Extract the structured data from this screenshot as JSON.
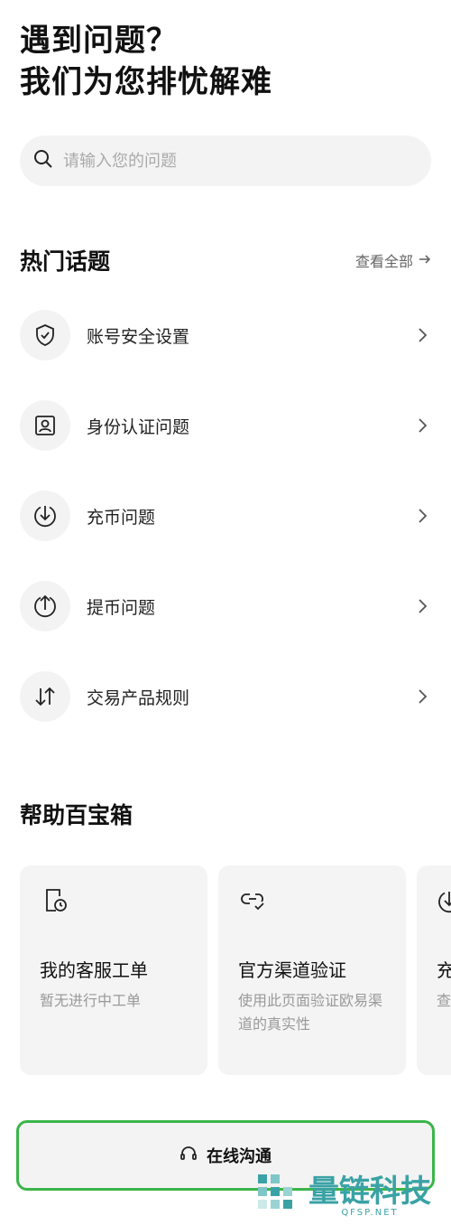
{
  "header": {
    "title_line1": "遇到问题？",
    "title_line2": "我们为您排忧解难"
  },
  "search": {
    "placeholder": "请输入您的问题"
  },
  "hot_topics": {
    "title": "热门话题",
    "view_all": "查看全部",
    "items": [
      {
        "label": "账号安全设置",
        "icon": "shield-check-icon"
      },
      {
        "label": "身份认证问题",
        "icon": "id-card-icon"
      },
      {
        "label": "充币问题",
        "icon": "arrow-down-circle-icon"
      },
      {
        "label": "提币问题",
        "icon": "arrow-up-circle-icon"
      },
      {
        "label": "交易产品规则",
        "icon": "swap-arrows-icon"
      }
    ]
  },
  "toolbox": {
    "title": "帮助百宝箱",
    "cards": [
      {
        "title": "我的客服工单",
        "subtitle": "暂无进行中工单",
        "icon": "ticket-clock-icon"
      },
      {
        "title": "官方渠道验证",
        "subtitle": "使用此页面验证欧易渠道的真实性",
        "icon": "link-check-icon"
      },
      {
        "title": "充",
        "subtitle": "查",
        "icon": "download-icon"
      }
    ]
  },
  "chat_button": {
    "label": "在线沟通",
    "icon": "headset-icon"
  },
  "watermark": {
    "text": "量链科技",
    "sub": "QFSP.NET"
  },
  "colors": {
    "accent_green": "#3bb54a",
    "watermark_teal": "#3aa2a5"
  }
}
